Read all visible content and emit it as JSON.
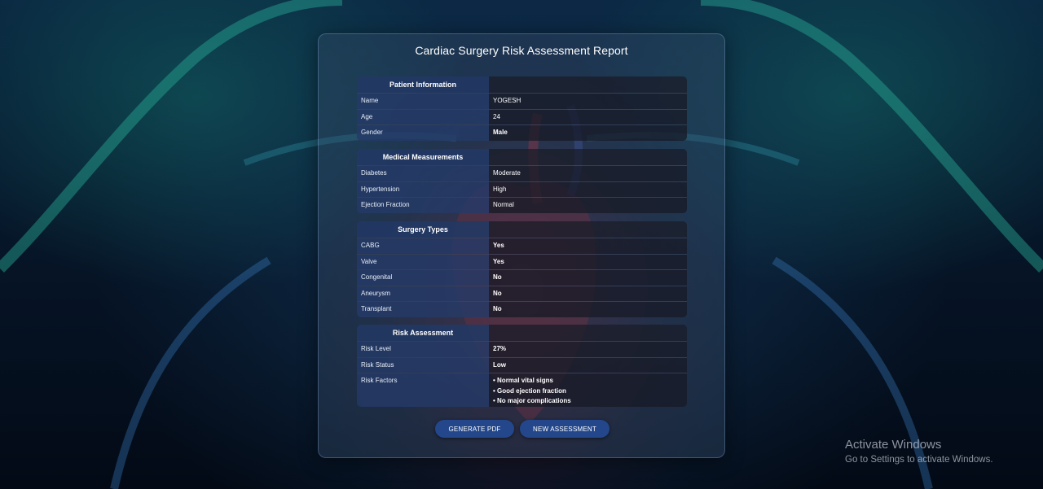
{
  "report": {
    "title": "Cardiac Surgery Risk Assessment Report",
    "sections": [
      {
        "heading": "Patient Information",
        "rows": [
          {
            "label": "Name",
            "value": "YOGESH"
          },
          {
            "label": "Age",
            "value": "24"
          },
          {
            "label": "Gender",
            "value": "Male"
          }
        ]
      },
      {
        "heading": "Medical Measurements",
        "rows": [
          {
            "label": "Diabetes",
            "value": "Moderate"
          },
          {
            "label": "Hypertension",
            "value": "High"
          },
          {
            "label": "Ejection Fraction",
            "value": "Normal"
          }
        ]
      },
      {
        "heading": "Surgery Types",
        "rows": [
          {
            "label": "CABG",
            "value": "Yes"
          },
          {
            "label": "Valve",
            "value": "Yes"
          },
          {
            "label": "Congenital",
            "value": "No"
          },
          {
            "label": "Aneurysm",
            "value": "No"
          },
          {
            "label": "Transplant",
            "value": "No"
          }
        ]
      },
      {
        "heading": "Risk Assessment",
        "rows": [
          {
            "label": "Risk Level",
            "value": "27%"
          },
          {
            "label": "Risk Status",
            "value": "Low"
          }
        ],
        "factors_label": "Risk Factors",
        "factors": [
          "• Normal vital signs",
          "• Good ejection fraction",
          "• No major complications"
        ]
      }
    ],
    "buttons": {
      "generate_pdf": "GENERATE PDF",
      "new_assessment": "NEW ASSESSMENT"
    }
  },
  "watermark": {
    "line1": "Activate Windows",
    "line2": "Go to Settings to activate Windows."
  },
  "colors": {
    "button": "#23478a",
    "header_cell": "#233c6e",
    "background": "#04101f"
  },
  "icons": {
    "background_image": "chest-heart-illustration"
  }
}
